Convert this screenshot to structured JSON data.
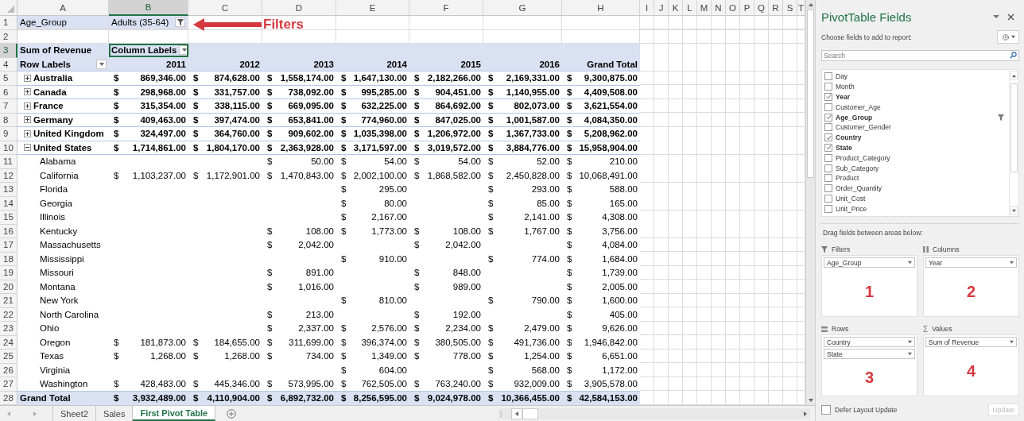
{
  "sheet": {
    "columns": [
      {
        "letter": "A",
        "selected": false
      },
      {
        "letter": "B",
        "selected": true
      },
      {
        "letter": "C",
        "selected": false
      },
      {
        "letter": "D",
        "selected": false
      },
      {
        "letter": "E",
        "selected": false
      },
      {
        "letter": "F",
        "selected": false
      },
      {
        "letter": "G",
        "selected": false
      },
      {
        "letter": "H",
        "selected": false
      },
      {
        "letter": "I",
        "selected": false
      },
      {
        "letter": "J",
        "selected": false
      },
      {
        "letter": "K",
        "selected": false
      },
      {
        "letter": "L",
        "selected": false
      },
      {
        "letter": "M",
        "selected": false
      },
      {
        "letter": "N",
        "selected": false
      },
      {
        "letter": "O",
        "selected": false
      },
      {
        "letter": "P",
        "selected": false
      },
      {
        "letter": "Q",
        "selected": false
      },
      {
        "letter": "R",
        "selected": false
      },
      {
        "letter": "S",
        "selected": false
      },
      {
        "letter": "T",
        "selected": false
      }
    ],
    "row_headers": [
      {
        "number": "1",
        "selected": false
      },
      {
        "number": "2",
        "selected": false
      },
      {
        "number": "3",
        "selected": true
      },
      {
        "number": "4",
        "selected": false
      },
      {
        "number": "5",
        "selected": false
      },
      {
        "number": "6",
        "selected": false
      },
      {
        "number": "7",
        "selected": false
      },
      {
        "number": "8",
        "selected": false
      },
      {
        "number": "9",
        "selected": false
      },
      {
        "number": "10",
        "selected": false
      },
      {
        "number": "11",
        "selected": false
      },
      {
        "number": "12",
        "selected": false
      },
      {
        "number": "13",
        "selected": false
      },
      {
        "number": "14",
        "selected": false
      },
      {
        "number": "15",
        "selected": false
      },
      {
        "number": "16",
        "selected": false
      },
      {
        "number": "17",
        "selected": false
      },
      {
        "number": "18",
        "selected": false
      },
      {
        "number": "19",
        "selected": false
      },
      {
        "number": "20",
        "selected": false
      },
      {
        "number": "21",
        "selected": false
      },
      {
        "number": "22",
        "selected": false
      },
      {
        "number": "23",
        "selected": false
      },
      {
        "number": "24",
        "selected": false
      },
      {
        "number": "25",
        "selected": false
      },
      {
        "number": "26",
        "selected": false
      },
      {
        "number": "27",
        "selected": false
      },
      {
        "number": "28",
        "selected": false
      }
    ],
    "report_filter": {
      "field": "Age_Group",
      "value": "Adults (35-64)"
    },
    "annotation": {
      "text": "Filters"
    },
    "pivot": {
      "value_label": "Sum of Revenue",
      "column_labels": "Column Labels",
      "row_labels": "Row Labels",
      "column_headers": [
        "2011",
        "2012",
        "2013",
        "2014",
        "2015",
        "2016",
        "Grand Total"
      ],
      "rows": [
        {
          "kind": "country",
          "label": "Australia",
          "expanded": false,
          "values": [
            "$ 869,346.00",
            "$ 874,628.00",
            "$ 1,558,174.00",
            "$ 1,647,130.00",
            "$ 2,182,266.00",
            "$ 2,169,331.00",
            "$ 9,300,875.00"
          ]
        },
        {
          "kind": "country",
          "label": "Canada",
          "expanded": false,
          "values": [
            "$ 298,968.00",
            "$ 331,757.00",
            "$ 738,092.00",
            "$ 995,285.00",
            "$ 904,451.00",
            "$ 1,140,955.00",
            "$ 4,409,508.00"
          ]
        },
        {
          "kind": "country",
          "label": "France",
          "expanded": false,
          "values": [
            "$ 315,354.00",
            "$ 338,115.00",
            "$ 669,095.00",
            "$ 632,225.00",
            "$ 864,692.00",
            "$ 802,073.00",
            "$ 3,621,554.00"
          ]
        },
        {
          "kind": "country",
          "label": "Germany",
          "expanded": false,
          "values": [
            "$ 409,463.00",
            "$ 397,474.00",
            "$ 653,841.00",
            "$ 774,960.00",
            "$ 847,025.00",
            "$ 1,001,587.00",
            "$ 4,084,350.00"
          ]
        },
        {
          "kind": "country",
          "label": "United Kingdom",
          "expanded": false,
          "values": [
            "$ 324,497.00",
            "$ 364,760.00",
            "$ 909,602.00",
            "$ 1,035,398.00",
            "$ 1,206,972.00",
            "$ 1,367,733.00",
            "$ 5,208,962.00"
          ]
        },
        {
          "kind": "country",
          "label": "United States",
          "expanded": true,
          "values": [
            "$ 1,714,861.00",
            "$ 1,804,170.00",
            "$ 2,363,928.00",
            "$ 3,171,597.00",
            "$ 3,019,572.00",
            "$ 3,884,776.00",
            "$ 15,958,904.00"
          ]
        },
        {
          "kind": "state",
          "label": "Alabama",
          "values": [
            {
              "kind": "blank"
            },
            {
              "kind": "blank"
            },
            "$ 50.00",
            "$ 54.00",
            "$ 54.00",
            "$ 52.00",
            "$ 210.00"
          ]
        },
        {
          "kind": "state",
          "label": "California",
          "values": [
            "$ 1,103,237.00",
            "$ 1,172,901.00",
            "$ 1,470,843.00",
            "$ 2,002,100.00",
            "$ 1,868,582.00",
            "$ 2,450,828.00",
            "$ 10,068,491.00"
          ]
        },
        {
          "kind": "state",
          "label": "Florida",
          "values": [
            {
              "kind": "blank"
            },
            {
              "kind": "blank"
            },
            {
              "kind": "blank"
            },
            "$ 295.00",
            {
              "kind": "blank"
            },
            "$ 293.00",
            "$ 588.00"
          ]
        },
        {
          "kind": "state",
          "label": "Georgia",
          "values": [
            {
              "kind": "blank"
            },
            {
              "kind": "blank"
            },
            {
              "kind": "blank"
            },
            "$ 80.00",
            {
              "kind": "blank"
            },
            "$ 85.00",
            "$ 165.00"
          ]
        },
        {
          "kind": "state",
          "label": "Illinois",
          "values": [
            {
              "kind": "blank"
            },
            {
              "kind": "blank"
            },
            {
              "kind": "blank"
            },
            "$ 2,167.00",
            {
              "kind": "blank"
            },
            "$ 2,141.00",
            "$ 4,308.00"
          ]
        },
        {
          "kind": "state",
          "label": "Kentucky",
          "values": [
            {
              "kind": "blank"
            },
            {
              "kind": "blank"
            },
            "$ 108.00",
            "$ 1,773.00",
            "$ 108.00",
            "$ 1,767.00",
            "$ 3,756.00"
          ]
        },
        {
          "kind": "state",
          "label": "Massachusetts",
          "values": [
            {
              "kind": "blank"
            },
            {
              "kind": "blank"
            },
            "$ 2,042.00",
            {
              "kind": "blank"
            },
            "$ 2,042.00",
            {
              "kind": "blank"
            },
            "$ 4,084.00"
          ]
        },
        {
          "kind": "state",
          "label": "Mississippi",
          "values": [
            {
              "kind": "blank"
            },
            {
              "kind": "blank"
            },
            {
              "kind": "blank"
            },
            "$ 910.00",
            {
              "kind": "blank"
            },
            "$ 774.00",
            "$ 1,684.00"
          ]
        },
        {
          "kind": "state",
          "label": "Missouri",
          "values": [
            {
              "kind": "blank"
            },
            {
              "kind": "blank"
            },
            "$ 891.00",
            {
              "kind": "blank"
            },
            "$ 848.00",
            {
              "kind": "blank"
            },
            "$ 1,739.00"
          ]
        },
        {
          "kind": "state",
          "label": "Montana",
          "values": [
            {
              "kind": "blank"
            },
            {
              "kind": "blank"
            },
            "$ 1,016.00",
            {
              "kind": "blank"
            },
            "$ 989.00",
            {
              "kind": "blank"
            },
            "$ 2,005.00"
          ]
        },
        {
          "kind": "state",
          "label": "New York",
          "values": [
            {
              "kind": "blank"
            },
            {
              "kind": "blank"
            },
            {
              "kind": "blank"
            },
            "$ 810.00",
            {
              "kind": "blank"
            },
            "$ 790.00",
            "$ 1,600.00"
          ]
        },
        {
          "kind": "state",
          "label": "North Carolina",
          "values": [
            {
              "kind": "blank"
            },
            {
              "kind": "blank"
            },
            "$ 213.00",
            {
              "kind": "blank"
            },
            "$ 192.00",
            {
              "kind": "blank"
            },
            "$ 405.00"
          ]
        },
        {
          "kind": "state",
          "label": "Ohio",
          "values": [
            {
              "kind": "blank"
            },
            {
              "kind": "blank"
            },
            "$ 2,337.00",
            "$ 2,576.00",
            "$ 2,234.00",
            "$ 2,479.00",
            "$ 9,626.00"
          ]
        },
        {
          "kind": "state",
          "label": "Oregon",
          "values": [
            "$ 181,873.00",
            "$ 184,655.00",
            "$ 311,699.00",
            "$ 396,374.00",
            "$ 380,505.00",
            "$ 491,736.00",
            "$ 1,946,842.00"
          ]
        },
        {
          "kind": "state",
          "label": "Texas",
          "values": [
            "$ 1,268.00",
            "$ 1,268.00",
            "$ 734.00",
            "$ 1,349.00",
            "$ 778.00",
            "$ 1,254.00",
            "$ 6,651.00"
          ]
        },
        {
          "kind": "state",
          "label": "Virginia",
          "values": [
            {
              "kind": "blank"
            },
            {
              "kind": "blank"
            },
            {
              "kind": "blank"
            },
            "$ 604.00",
            {
              "kind": "blank"
            },
            "$ 568.00",
            "$ 1,172.00"
          ]
        },
        {
          "kind": "state",
          "label": "Washington",
          "values": [
            "$ 428,483.00",
            "$ 445,346.00",
            "$ 573,995.00",
            "$ 762,505.00",
            "$ 763,240.00",
            "$ 932,009.00",
            "$ 3,905,578.00"
          ]
        }
      ],
      "grand_total": {
        "label": "Grand Total",
        "values": [
          "$ 3,932,489.00",
          "$ 4,110,904.00",
          "$ 6,892,732.00",
          "$ 8,256,595.00",
          "$ 9,024,978.00",
          "$ 10,366,455.00",
          "$ 42,584,153.00"
        ]
      }
    }
  },
  "sheet_tabs": [
    {
      "label": "Sheet2",
      "selected": false
    },
    {
      "label": "Sales",
      "selected": false
    },
    {
      "label": "First Pivot Table",
      "selected": true
    }
  ],
  "pivot_fields": {
    "title": "PivotTable Fields",
    "instruction": "Choose fields to add to report:",
    "search": {
      "placeholder": "Search"
    },
    "items": [
      {
        "label": "Day",
        "checked": false,
        "filtered": false
      },
      {
        "label": "Month",
        "checked": false,
        "filtered": false
      },
      {
        "label": "Year",
        "checked": true,
        "filtered": false
      },
      {
        "label": "Customer_Age",
        "checked": false,
        "filtered": false
      },
      {
        "label": "Age_Group",
        "checked": true,
        "filtered": true
      },
      {
        "label": "Customer_Gender",
        "checked": false,
        "filtered": false
      },
      {
        "label": "Country",
        "checked": true,
        "filtered": false
      },
      {
        "label": "State",
        "checked": true,
        "filtered": false
      },
      {
        "label": "Product_Category",
        "checked": false,
        "filtered": false
      },
      {
        "label": "Sub_Category",
        "checked": false,
        "filtered": false
      },
      {
        "label": "Product",
        "checked": false,
        "filtered": false
      },
      {
        "label": "Order_Quantity",
        "checked": false,
        "filtered": false
      },
      {
        "label": "Unit_Cost",
        "checked": false,
        "filtered": false
      },
      {
        "label": "Unit_Price",
        "checked": false,
        "filtered": false
      }
    ],
    "areas_instruction": "Drag fields between areas below:",
    "areas": [
      {
        "kind": "filters",
        "title": "Filters",
        "fields": [
          "Age_Group"
        ],
        "number": "1"
      },
      {
        "kind": "columns",
        "title": "Columns",
        "fields": [
          "Year"
        ],
        "number": "2"
      },
      {
        "kind": "rows",
        "title": "Rows",
        "fields": [
          "Country",
          "State"
        ],
        "number": "3"
      },
      {
        "kind": "values",
        "icon": "Σ",
        "title": "Values",
        "fields": [
          "Sum of Revenue"
        ],
        "number": "4"
      }
    ],
    "defer_update": {
      "label": "Defer Layout Update",
      "checked": false
    },
    "update_button": {
      "label": "Update",
      "disabled": true
    }
  }
}
